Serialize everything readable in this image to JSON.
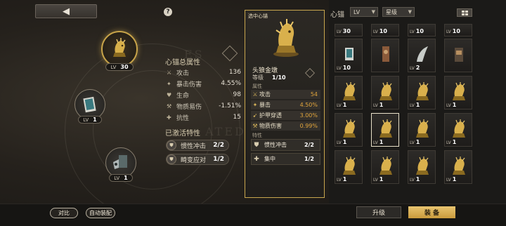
{
  "header": {
    "back_icon": "◀",
    "help_icon": "?"
  },
  "slots": {
    "main": {
      "lv_label": "LV",
      "lv_value": "30"
    },
    "slot2": {
      "lv_label": "LV",
      "lv_value": "1"
    },
    "slot3": {
      "lv_label": "LV",
      "lv_value": "1"
    }
  },
  "totals": {
    "title": "心锚总属性",
    "rows": [
      {
        "icon": "sword-icon",
        "glyph": "⚔",
        "name": "攻击",
        "value": "136",
        "extra": "⊤"
      },
      {
        "icon": "crit-icon",
        "glyph": "✦",
        "name": "暴击伤害",
        "value": "4.55%",
        "extra": "◎"
      },
      {
        "icon": "heart-icon",
        "glyph": "♥",
        "name": "生命",
        "value": "98",
        "extra": "◆"
      },
      {
        "icon": "vuln-icon",
        "glyph": "⚒",
        "name": "物质易伤",
        "value": "-1.51%",
        "extra": "⊕"
      },
      {
        "icon": "resist-icon",
        "glyph": "✚",
        "name": "抗性",
        "value": "15",
        "extra": "◈"
      }
    ],
    "traits_title": "已激活特性",
    "traits": [
      {
        "name": "惯性冲击",
        "value": "2/2"
      },
      {
        "name": "畸变应对",
        "value": "1/2"
      }
    ]
  },
  "popup": {
    "header": "选中心锚",
    "name": "头狼金墩",
    "level_label": "等级",
    "level_value": "1/10",
    "attr_label": "属性",
    "stats": [
      {
        "name": "攻击",
        "value": "54"
      },
      {
        "name": "暴击",
        "value": "4.50%"
      },
      {
        "name": "护甲穿透",
        "value": "3.00%"
      },
      {
        "name": "物质伤害",
        "value": "0.99%"
      }
    ],
    "trait_label": "特性",
    "traits": [
      {
        "name": "惯性冲击",
        "value": "2/2"
      },
      {
        "name": "集中",
        "value": "1/2"
      }
    ]
  },
  "inventory": {
    "title": "心锚",
    "filter_level": "LV",
    "filter_rarity": "星级",
    "grid_rows": [
      [
        "30",
        "10",
        "10",
        "10"
      ],
      [
        "10",
        "",
        "2",
        ""
      ],
      [
        "1",
        "1",
        "1",
        "1"
      ],
      [
        "1",
        "1",
        "1",
        "1"
      ],
      [
        "1",
        "1",
        "1",
        "1"
      ]
    ]
  },
  "footer": {
    "compare": "对比",
    "auto_equip": "自动装配",
    "upgrade": "升级",
    "equip": "装 备"
  },
  "colors": {
    "accent_gold": "#c8a64e",
    "value_orange": "#e0a43c",
    "equip_button": "#d9ae55"
  }
}
